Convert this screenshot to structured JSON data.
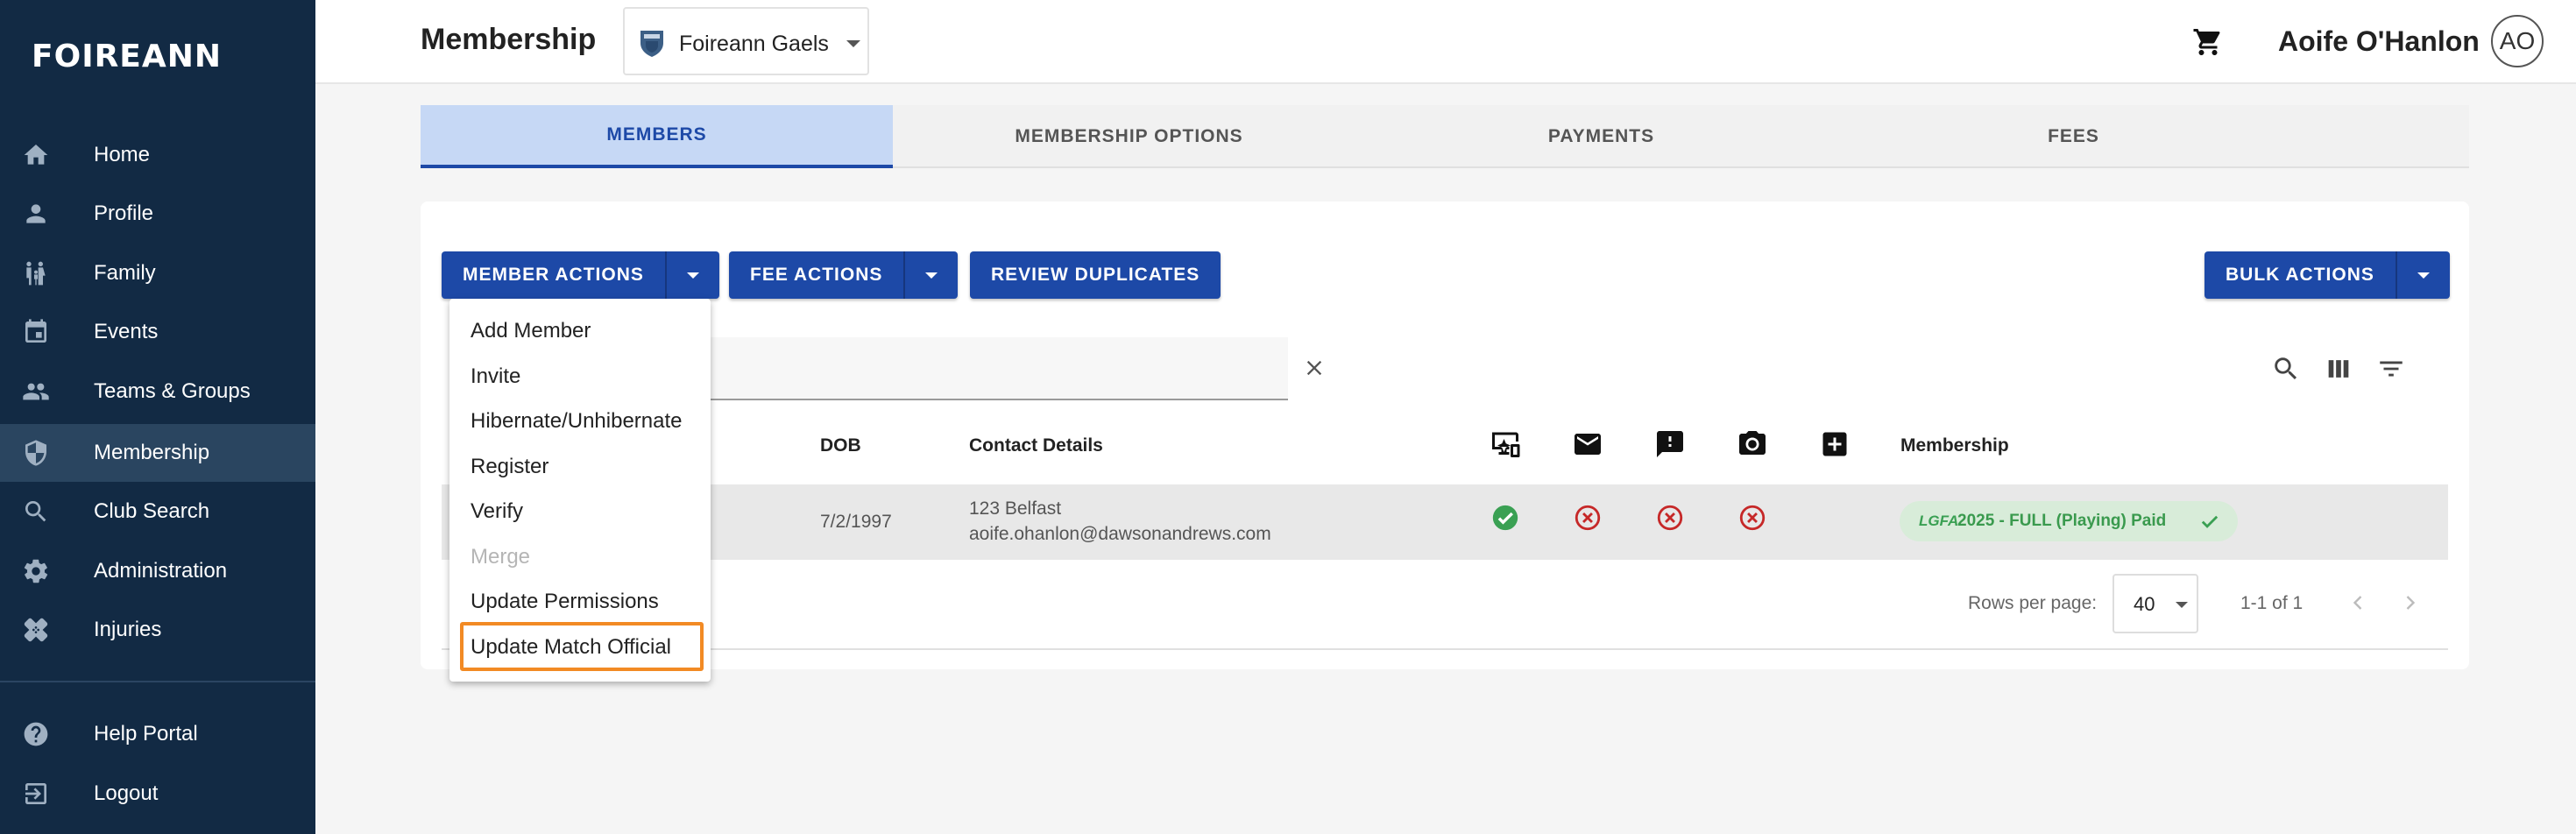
{
  "brand": {
    "logo": "FOIREANN"
  },
  "sidebar": {
    "items": [
      {
        "label": "Home",
        "icon": "home-icon"
      },
      {
        "label": "Profile",
        "icon": "person-icon"
      },
      {
        "label": "Family",
        "icon": "family-icon"
      },
      {
        "label": "Events",
        "icon": "calendar-icon"
      },
      {
        "label": "Teams & Groups",
        "icon": "group-icon"
      },
      {
        "label": "Membership",
        "icon": "shield-icon",
        "active": true
      },
      {
        "label": "Club Search",
        "icon": "search-icon"
      },
      {
        "label": "Administration",
        "icon": "gear-icon"
      },
      {
        "label": "Injuries",
        "icon": "bandage-icon"
      },
      {
        "label": "Help Portal",
        "icon": "help-icon"
      },
      {
        "label": "Logout",
        "icon": "logout-icon"
      }
    ]
  },
  "header": {
    "title": "Membership",
    "club": "Foireann Gaels",
    "user_name": "Aoife O'Hanlon",
    "user_initials": "AO"
  },
  "tabs": [
    {
      "label": "MEMBERS",
      "active": true
    },
    {
      "label": "MEMBERSHIP OPTIONS"
    },
    {
      "label": "PAYMENTS"
    },
    {
      "label": "FEES"
    }
  ],
  "actions": {
    "member_actions": "MEMBER ACTIONS",
    "fee_actions": "FEE ACTIONS",
    "review_duplicates": "REVIEW DUPLICATES",
    "bulk_actions": "BULK ACTIONS"
  },
  "member_actions_menu": [
    {
      "label": "Add Member"
    },
    {
      "label": "Invite"
    },
    {
      "label": "Hibernate/Unhibernate"
    },
    {
      "label": "Register"
    },
    {
      "label": "Verify"
    },
    {
      "label": "Merge",
      "disabled": true
    },
    {
      "label": "Update Permissions"
    },
    {
      "label": "Update Match Official",
      "highlighted": true
    }
  ],
  "table": {
    "headers": {
      "dob": "DOB",
      "contact": "Contact Details",
      "membership": "Membership"
    },
    "header_icons": [
      "online-icon",
      "email-icon",
      "feedback-icon",
      "camera-icon",
      "medical-icon"
    ],
    "rows": [
      {
        "dob": "7/2/1997",
        "address": "123 Belfast",
        "email": "aoife.ohanlon@dawsonandrews.com",
        "statuses": [
          "check-circle-icon",
          "cancel-circle-icon",
          "cancel-circle-icon",
          "cancel-circle-icon"
        ],
        "membership_badge": "LGFA",
        "membership": "2025 - FULL (Playing) Paid"
      }
    ]
  },
  "pagination": {
    "rows_per_page_label": "Rows per page:",
    "rows_per_page": "40",
    "range": "1-1 of 1"
  },
  "colors": {
    "sidebar_bg": "#122a44",
    "primary": "#1d49a7",
    "active_tab_bg": "#c6d8f5",
    "success": "#3aa053",
    "error": "#c62828",
    "highlight": "#f28a24"
  }
}
